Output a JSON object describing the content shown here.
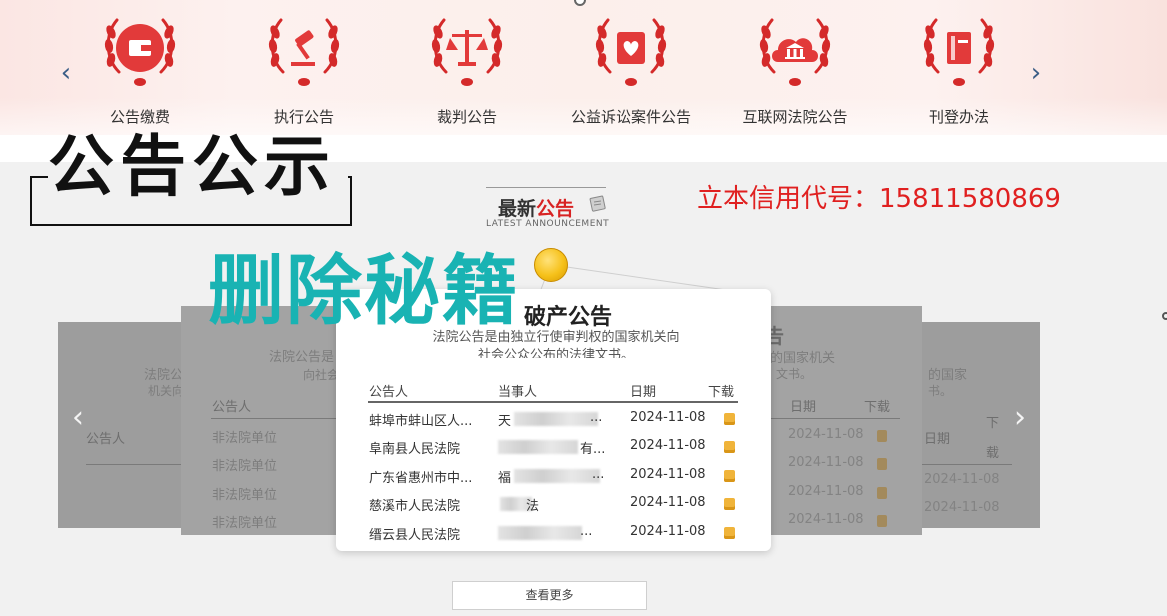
{
  "categories": [
    {
      "label": "公告缴费",
      "icon": "wallet-icon"
    },
    {
      "label": "执行公告",
      "icon": "gavel-icon"
    },
    {
      "label": "裁判公告",
      "icon": "scales-icon"
    },
    {
      "label": "公益诉讼案件公告",
      "icon": "heart-document-icon"
    },
    {
      "label": "互联网法院公告",
      "icon": "court-cloud-icon"
    },
    {
      "label": "刊登办法",
      "icon": "book-icon"
    }
  ],
  "overlay": {
    "heading": "公告公示",
    "credit_code": "立本信用代号：15811580869",
    "promo": "删除秘籍"
  },
  "latest": {
    "title_a": "最新",
    "title_b": "公告",
    "subtitle": "LATEST ANNOUNCEMENT"
  },
  "front_card": {
    "title": "破产公告",
    "desc_line1": "法院公告是由独立行使审判权的国家机关向",
    "desc_line2": "社会公众公布的法律文书。",
    "columns": [
      "公告人",
      "当事人",
      "日期",
      "下载"
    ],
    "rows": [
      {
        "publisher": "蚌埠市蚌山区人...",
        "party": "天",
        "party_tail": "...",
        "date": "2024-11-08"
      },
      {
        "publisher": "阜南县人民法院",
        "party": "",
        "party_tail": "有...",
        "date": "2024-11-08"
      },
      {
        "publisher": "广东省惠州市中...",
        "party": "福",
        "party_tail": "...",
        "date": "2024-11-08"
      },
      {
        "publisher": "慈溪市人民法院",
        "party": "",
        "party_tail": "法",
        "date": "2024-11-08"
      },
      {
        "publisher": "缙云县人民法院",
        "party": "",
        "party_tail": "...",
        "date": "2024-11-08"
      }
    ]
  },
  "left_card": {
    "title_partial": "法院公告是",
    "desc_partial": "向社会",
    "column": "公告人",
    "rows": [
      "非法院单位",
      "非法院单位",
      "非法院单位",
      "非法院单位"
    ]
  },
  "far_left_card": {
    "title_partial": "法院公",
    "desc_partial": "机关向",
    "column": "公告人"
  },
  "right_card": {
    "title_partial": "告",
    "desc_partial": "的国家机关",
    "desc2_partial": "文书。",
    "columns": [
      "日期",
      "下载"
    ],
    "dates": [
      "2024-11-08",
      "2024-11-08",
      "2024-11-08",
      "2024-11-08"
    ]
  },
  "far_right_card": {
    "desc_partial": "的国家",
    "desc2_partial": "书。",
    "col_date": "日期",
    "col_dl_1": "下",
    "col_dl_2": "载",
    "dates": [
      "2024-11-08",
      "2024-11-08"
    ]
  },
  "more_button": "查看更多",
  "arrows": {
    "left": "‹",
    "right": "›"
  }
}
